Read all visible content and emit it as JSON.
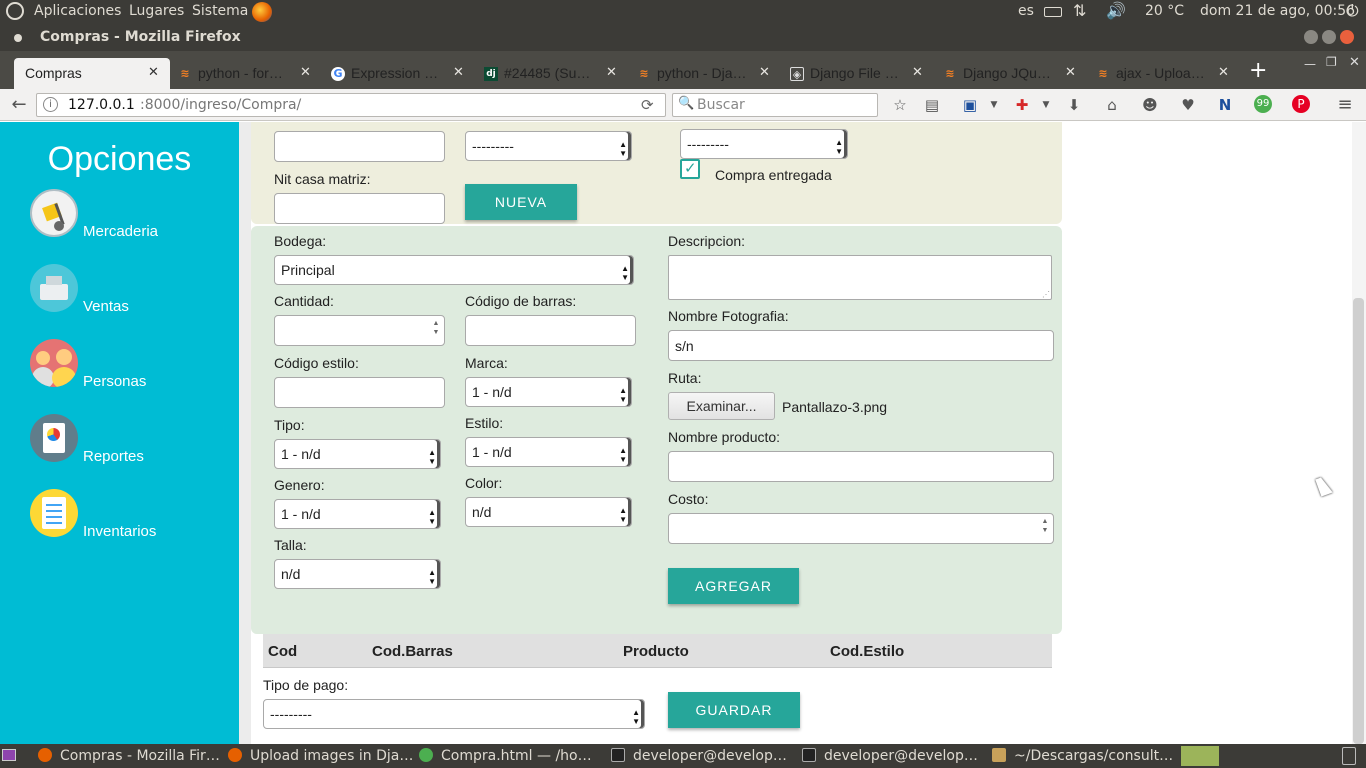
{
  "system_bar": {
    "apps": "Aplicaciones",
    "places": "Lugares",
    "system": "Sistema",
    "lang": "es",
    "temp": "20 °C",
    "datetime": "dom 21 de ago, 00:56"
  },
  "window": {
    "title": "Compras - Mozilla Firefox"
  },
  "tabs": [
    {
      "label": "Compras",
      "icon": "none"
    },
    {
      "label": "python - for…",
      "icon": "stackoverflow-icon"
    },
    {
      "label": "Expression …",
      "icon": "google-icon"
    },
    {
      "label": "#24485 (Su…",
      "icon": "django-icon"
    },
    {
      "label": "python - Dja…",
      "icon": "stackoverflow-icon"
    },
    {
      "label": "Django File …",
      "icon": "site-icon"
    },
    {
      "label": "Django JQu…",
      "icon": "stackoverflow-icon"
    },
    {
      "label": "ajax - Uploa…",
      "icon": "stackoverflow-icon"
    }
  ],
  "nav": {
    "url_host": "127.0.0.1",
    "url_rest": ":8000/ingreso/Compra/",
    "search_placeholder": "Buscar"
  },
  "sidebar": {
    "title": "Opciones",
    "items": [
      {
        "label": "Mercaderia",
        "icon": "hand-truck-icon"
      },
      {
        "label": "Ventas",
        "icon": "cash-register-icon"
      },
      {
        "label": "Personas",
        "icon": "people-icon"
      },
      {
        "label": "Reportes",
        "icon": "report-icon"
      },
      {
        "label": "Inventarios",
        "icon": "checklist-icon"
      }
    ]
  },
  "form_top": {
    "select1_value": "---------",
    "select2_value": "---------",
    "checkbox_label": "Compra entregada",
    "checkbox_checked": true,
    "nit_label": "Nit casa matriz:",
    "new_button": "NUEVA"
  },
  "form": {
    "bodega_label": "Bodega:",
    "bodega_value": "Principal",
    "descripcion_label": "Descripcion:",
    "cantidad_label": "Cantidad:",
    "codigo_barras_label": "Código de barras:",
    "nombre_foto_label": "Nombre Fotografia:",
    "nombre_foto_value": "s/n",
    "codigo_estilo_label": "Código estilo:",
    "marca_label": "Marca:",
    "marca_value": "1 - n/d",
    "ruta_label": "Ruta:",
    "browse_button": "Examinar...",
    "file_name": "Pantallazo-3.png",
    "tipo_label": "Tipo:",
    "tipo_value": "1 - n/d",
    "estilo_label": "Estilo:",
    "estilo_value": "1 - n/d",
    "nombre_producto_label": "Nombre producto:",
    "genero_label": "Genero:",
    "genero_value": "1 - n/d",
    "color_label": "Color:",
    "color_value": "n/d",
    "costo_label": "Costo:",
    "talla_label": "Talla:",
    "talla_value": "n/d",
    "add_button": "AGREGAR"
  },
  "table": {
    "columns": [
      "Cod",
      "Cod.Barras",
      "Producto",
      "Cod.Estilo"
    ]
  },
  "payment": {
    "label": "Tipo de pago:",
    "value": "---------",
    "save_button": "GUARDAR"
  },
  "taskbar": [
    {
      "label": "Compras - Mozilla Fir…"
    },
    {
      "label": "Upload images in Dja…"
    },
    {
      "label": "Compra.html — /ho…"
    },
    {
      "label": "developer@develop…"
    },
    {
      "label": "developer@develop…"
    },
    {
      "label": "~/Descargas/consult…"
    }
  ],
  "colors": {
    "sidebar": "#00bcd4",
    "button": "#26a69a",
    "panel_top": "#eeeedd",
    "panel_form": "#deebde"
  }
}
